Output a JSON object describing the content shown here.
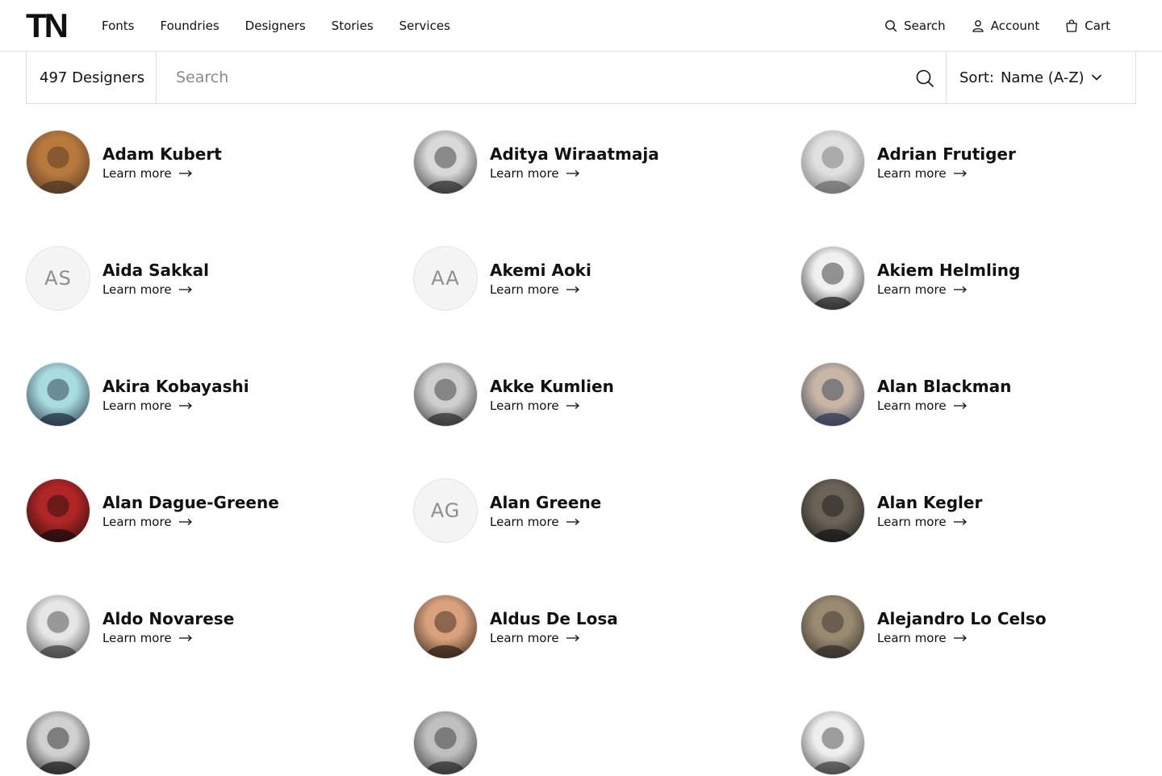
{
  "header": {
    "logo": "TN",
    "nav": [
      "Fonts",
      "Foundries",
      "Designers",
      "Stories",
      "Services"
    ],
    "search_label": "Search",
    "account_label": "Account",
    "cart_label": "Cart"
  },
  "filters": {
    "count_label": "497 Designers",
    "search_placeholder": "Search",
    "sort_label": "Sort:",
    "sort_value": "Name (A-Z)"
  },
  "designers": [
    {
      "name": "Adam Kubert",
      "link": "Learn more",
      "avatar": "photo",
      "palette": [
        "#b8793d",
        "#4b3423"
      ]
    },
    {
      "name": "Aditya Wiraatmaja",
      "link": "Learn more",
      "avatar": "photo",
      "palette": [
        "#d9d9d9",
        "#2b2b2b"
      ]
    },
    {
      "name": "Adrian Frutiger",
      "link": "Learn more",
      "avatar": "photo",
      "palette": [
        "#e0e0e0",
        "#6a6a6a"
      ]
    },
    {
      "name": "Aida Sakkal",
      "link": "Learn more",
      "avatar": "initials",
      "initials": "AS"
    },
    {
      "name": "Akemi Aoki",
      "link": "Learn more",
      "avatar": "initials",
      "initials": "AA"
    },
    {
      "name": "Akiem Helmling",
      "link": "Learn more",
      "avatar": "photo",
      "palette": [
        "#f0f0f0",
        "#1c1c1c"
      ]
    },
    {
      "name": "Akira Kobayashi",
      "link": "Learn more",
      "avatar": "photo",
      "palette": [
        "#a9dce0",
        "#1d2a3a"
      ]
    },
    {
      "name": "Akke Kumlien",
      "link": "Learn more",
      "avatar": "photo",
      "palette": [
        "#cfcfcf",
        "#2a2a2a"
      ]
    },
    {
      "name": "Alan Blackman",
      "link": "Learn more",
      "avatar": "photo",
      "palette": [
        "#c8b6a6",
        "#2b3550"
      ]
    },
    {
      "name": "Alan Dague-Greene",
      "link": "Learn more",
      "avatar": "photo",
      "palette": [
        "#b02525",
        "#1a0c0c"
      ]
    },
    {
      "name": "Alan Greene",
      "link": "Learn more",
      "avatar": "initials",
      "initials": "AG"
    },
    {
      "name": "Alan Kegler",
      "link": "Learn more",
      "avatar": "photo",
      "palette": [
        "#6b6357",
        "#151513"
      ]
    },
    {
      "name": "Aldo Novarese",
      "link": "Learn more",
      "avatar": "photo",
      "palette": [
        "#e6e6e6",
        "#3a3a3a"
      ]
    },
    {
      "name": "Aldus De Losa",
      "link": "Learn more",
      "avatar": "photo",
      "palette": [
        "#d9a27d",
        "#2a1c14"
      ]
    },
    {
      "name": "Alejandro Lo Celso",
      "link": "Learn more",
      "avatar": "photo",
      "palette": [
        "#9b8a72",
        "#2e2a24"
      ]
    },
    {
      "name": "",
      "link": "",
      "avatar": "photo",
      "palette": [
        "#d0d0d0",
        "#1a1a1a"
      ]
    },
    {
      "name": "",
      "link": "",
      "avatar": "photo",
      "palette": [
        "#c0c0c0",
        "#2a2a2a"
      ]
    },
    {
      "name": "",
      "link": "",
      "avatar": "photo",
      "palette": [
        "#eeeeee",
        "#3a3a3a"
      ]
    }
  ]
}
